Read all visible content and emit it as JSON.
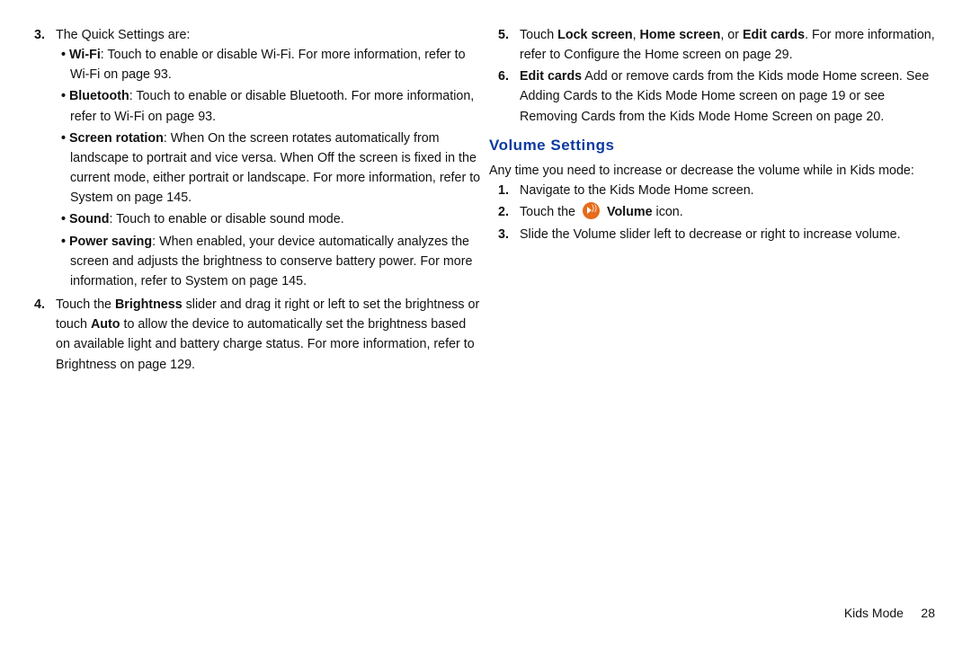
{
  "left": {
    "step3": {
      "num": "3.",
      "intro": "The Quick Settings are:",
      "bullets": [
        {
          "b": "Wi-Fi",
          "rest": ": Touch to enable or disable Wi-Fi. For more information, refer to ",
          "link": "Wi-Fi",
          "tail": " on page 93."
        },
        {
          "b": "Bluetooth",
          "rest": ": Touch to enable or disable Bluetooth. For more information, refer to ",
          "link": "Wi-Fi",
          "tail": " on page 93."
        },
        {
          "b": "Screen rotation",
          "rest": ": When On the screen rotates automatically from landscape to portrait and vice versa. When Off the screen is fixed in the current mode, either portrait or landscape. For more information, refer to ",
          "link": "System",
          "tail": " on page 145."
        },
        {
          "b": "Sound",
          "rest": ": Touch to enable or disable sound mode."
        },
        {
          "b": "Power saving",
          "rest": ": When enabled, your device automatically analyzes the screen and adjusts the brightness to conserve battery power. For more information, refer to ",
          "link": "System",
          "tail": " on page 145."
        }
      ]
    },
    "step4": {
      "num": "4.",
      "pre": "Touch the ",
      "b": "Brightness",
      "mid": " slider and drag it right or left to set the brightness or touch ",
      "b2": "Auto",
      "rest": " to allow the device to automatically set the brightness based on available light and battery charge status. For more information, refer to ",
      "link": "Brightness ",
      "tail": "on page 129."
    }
  },
  "right": {
    "step5": {
      "num": "5.",
      "pre": "Touch ",
      "b": "Lock screen",
      "mid": ", ",
      "b2": "Home screen",
      "mid2": ", or ",
      "b3": "Edit cards",
      "rest": ". For more information, refer to ",
      "link": "Configure the Home screen ",
      "tail": "on page 29."
    },
    "step6": {
      "num": "6.",
      "b": "Edit cards",
      "mid": " Add or remove cards from the Kids mode Home screen.  See ",
      "link": "Adding Cards to the Kids Mode Home screen ",
      "mid2": "on page 19 or see ",
      "link2": "Removing Cards from the Kids Mode Home Screen ",
      "tail": "on page 20."
    },
    "heading": "Volume Settings",
    "intro": "Any time you need to increase or decrease the volume while in Kids mode:",
    "v1": {
      "num": "1.",
      "text": "Navigate to the Kids Mode Home screen."
    },
    "v2": {
      "num": "2.",
      "pre": "Touch the ",
      "b": "Volume",
      "rest": " icon."
    },
    "v3": {
      "num": "3.",
      "text": "Slide the Volume slider left to decrease or right to increase volume."
    }
  },
  "footer": {
    "section": "Kids Mode",
    "page": "28"
  }
}
